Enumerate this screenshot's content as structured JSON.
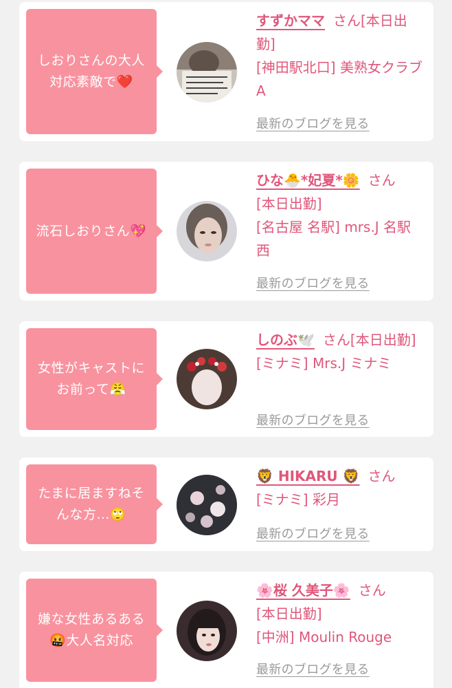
{
  "link_label": "最新のブログを見る",
  "san_label": "さん",
  "cards": [
    {
      "comment": "しおりさんの大人対応素敵で❤️",
      "name": "すずかママ",
      "status": "[本日出勤]",
      "shop": "[神田駅北口] 美熟女クラブA",
      "avatar": "photo-document"
    },
    {
      "comment": "流石しおりさん💖",
      "name": "ひな🐣*妃夏*🌼",
      "status": "[本日出勤]",
      "shop": "[名古屋 名駅] mrs.J 名駅西",
      "avatar": "photo-blur-face"
    },
    {
      "comment": "女性がキャストにお前って😤",
      "name": "しのぶ🕊️",
      "status": "[本日出勤]",
      "shop": "[ミナミ] Mrs.J ミナミ",
      "avatar": "photo-flower-crown"
    },
    {
      "comment": "たまに居ますねそんな方…🙄",
      "name": "🦁 HIKARU 🦁",
      "status": "",
      "shop": "[ミナミ] 彩月",
      "avatar": "photo-kimono"
    },
    {
      "comment": "嫌な女性あるある🤬大人名対応",
      "name": "🌸桜 久美子🌸",
      "status": "[本日出勤]",
      "shop": "[中洲] Moulin Rouge",
      "avatar": "photo-portrait"
    }
  ]
}
